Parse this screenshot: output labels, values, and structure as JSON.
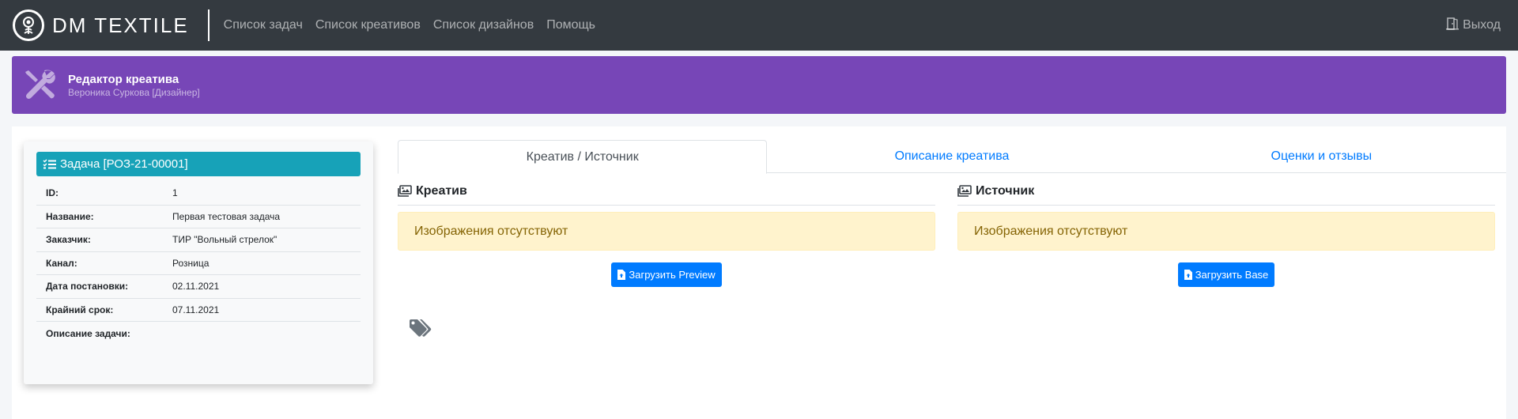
{
  "navbar": {
    "brand": "DM TEXTILE",
    "links": [
      "Список задач",
      "Список креативов",
      "Список дизайнов",
      "Помощь"
    ],
    "logout": "Выход"
  },
  "banner": {
    "title": "Редактор креатива",
    "subtitle": "Вероника Суркова [Дизайнер]"
  },
  "task": {
    "header": "Задача [РОЗ-21-00001]",
    "rows": [
      {
        "label": "ID:",
        "value": "1"
      },
      {
        "label": "Название:",
        "value": "Первая тестовая задача"
      },
      {
        "label": "Заказчик:",
        "value": "ТИР \"Вольный стрелок\""
      },
      {
        "label": "Канал:",
        "value": "Розница"
      },
      {
        "label": "Дата постановки:",
        "value": "02.11.2021"
      },
      {
        "label": "Крайний срок:",
        "value": "07.11.2021"
      },
      {
        "label": "Описание задачи:",
        "value": ""
      }
    ]
  },
  "tabs": [
    "Креатив / Источник",
    "Описание креатива",
    "Оценки и отзывы"
  ],
  "creative": {
    "title": "Креатив",
    "alert": "Изображения отсутствуют",
    "button": "Загрузить Preview"
  },
  "source": {
    "title": "Источник",
    "alert": "Изображения отсутствуют",
    "button": "Загрузить Base"
  },
  "colors": {
    "navbar": "#343a40",
    "banner": "#7746b7",
    "task_header": "#17a2b8",
    "primary": "#007bff",
    "warning_bg": "#fff3cd"
  },
  "icons": [
    "logo-icon",
    "door-icon",
    "tools-icon",
    "tasks-icon",
    "images-icon",
    "file-upload-icon",
    "tags-icon"
  ]
}
